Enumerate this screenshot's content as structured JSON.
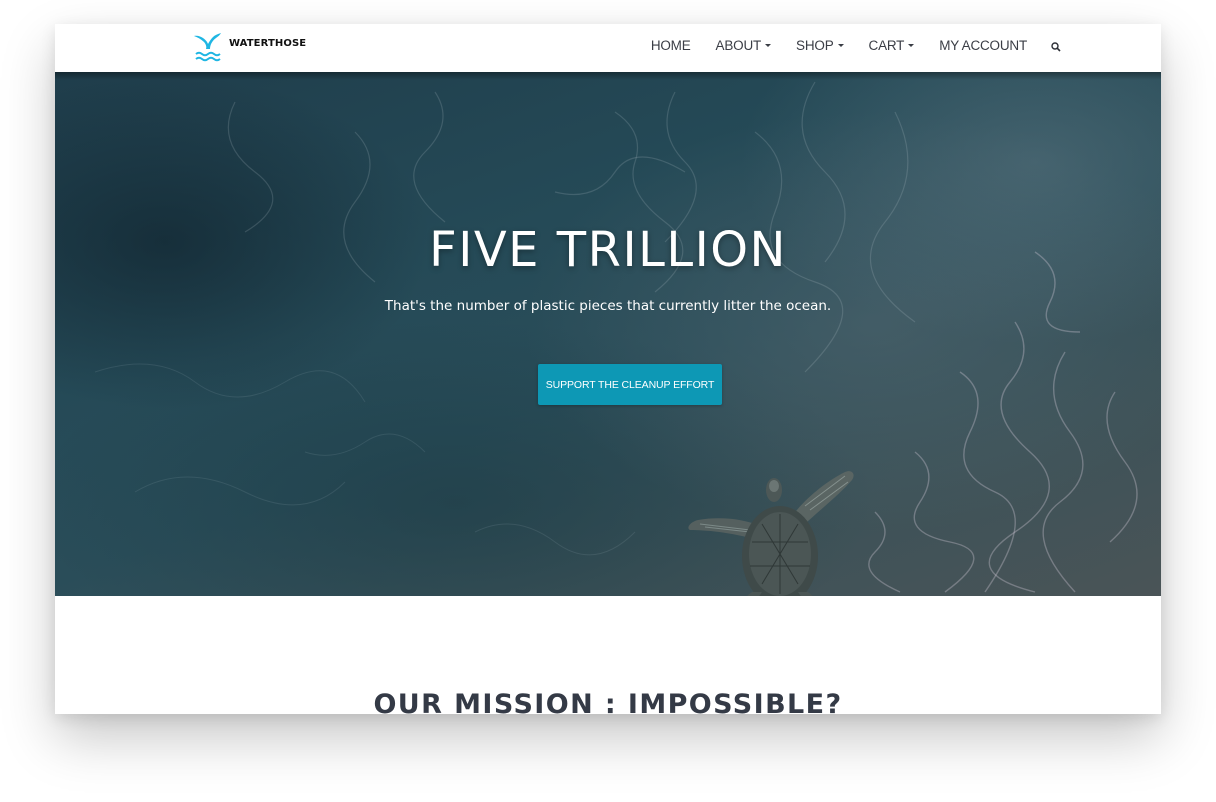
{
  "brand": {
    "name": "WATERTHOSE",
    "accent_color": "#1fb6e3"
  },
  "nav": {
    "items": [
      {
        "label": "HOME",
        "has_dropdown": false
      },
      {
        "label": "ABOUT",
        "has_dropdown": true
      },
      {
        "label": "SHOP",
        "has_dropdown": true
      },
      {
        "label": "CART",
        "has_dropdown": true
      },
      {
        "label": "MY ACCOUNT",
        "has_dropdown": false
      }
    ],
    "search_icon": "search-icon"
  },
  "hero": {
    "title": "FIVE TRILLION",
    "subtitle": "That's the number of plastic pieces that currently litter the ocean.",
    "cta_label": "SUPPORT THE CLEANUP EFFORT",
    "cta_color": "#0d98b5",
    "background_image": "ocean-turtle"
  },
  "mission": {
    "title": "OUR MISSION : IMPOSSIBLE?"
  }
}
